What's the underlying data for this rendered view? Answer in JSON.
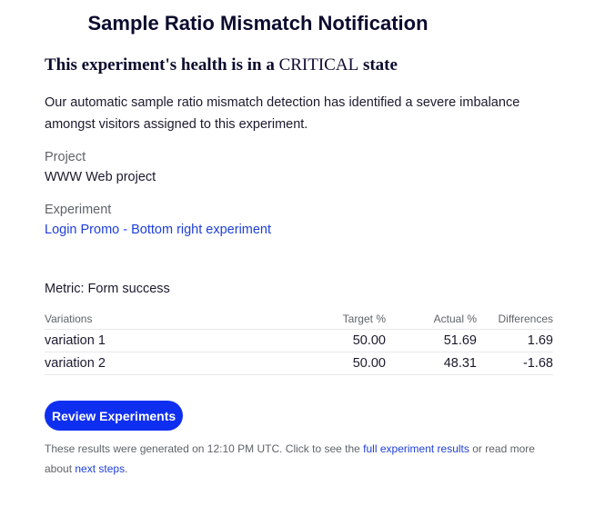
{
  "header": {
    "title": "Sample Ratio Mismatch Notification"
  },
  "health": {
    "prefix": "This experiment's health is in a ",
    "state": "CRITICAL",
    "suffix": " state"
  },
  "intro": "Our automatic sample ratio mismatch detection has identified a severe imbalance amongst visitors assigned to this experiment.",
  "project": {
    "label": "Project",
    "value": "WWW Web project"
  },
  "experiment": {
    "label": "Experiment",
    "link_text": "Login Promo - Bottom right experiment"
  },
  "metric": "Metric: Form success",
  "table": {
    "headers": {
      "variations": "Variations",
      "target": "Target %",
      "actual": "Actual %",
      "differences": "Differences"
    },
    "rows": [
      {
        "variation": "variation 1",
        "target": "50.00",
        "actual": "51.69",
        "difference": "1.69"
      },
      {
        "variation": "variation 2",
        "target": "50.00",
        "actual": "48.31",
        "difference": "-1.68"
      }
    ]
  },
  "review_button": "Review Experiments",
  "footer": {
    "text_1": "These results were generated on 12:10 PM UTC. Click to see the ",
    "link_results": "full experiment results",
    "text_2": " or read more about ",
    "link_next": "next steps",
    "text_3": "."
  },
  "colors": {
    "accent": "#0f2ff0",
    "link": "#1e3fd8",
    "text": "#1a1a2e",
    "muted": "#5f6368"
  }
}
